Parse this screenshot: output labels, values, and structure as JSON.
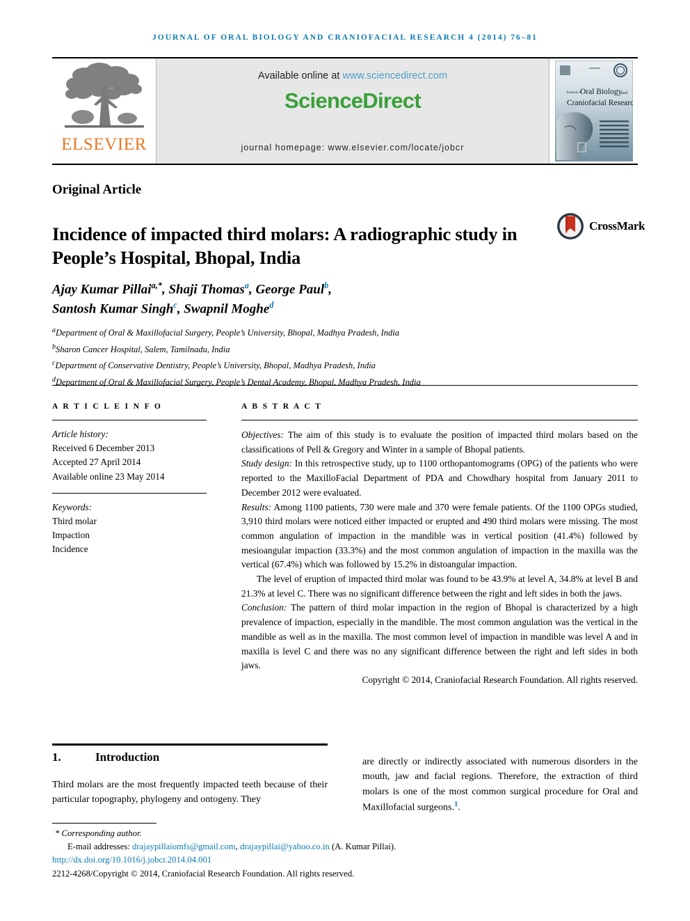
{
  "running_head": "Journal of Oral Biology and Craniofacial Research 4 (2014) 76–81",
  "masthead": {
    "publisher_logo_text": "ELSEVIER",
    "available_prefix": "Available online at ",
    "available_link": "www.sciencedirect.com",
    "sciencedirect_logo": "ScienceDirect",
    "journal_homepage": "journal homepage: www.elsevier.com/locate/jobcr",
    "cover": {
      "title_small": "Journal of",
      "title_main_1": "Oral Biology",
      "title_and": "and",
      "title_main_2": "Craniofacial Research"
    }
  },
  "article": {
    "type": "Original Article",
    "title": "Incidence of impacted third molars: A radiographic study in People’s Hospital, Bhopal, India",
    "crossmark_label": "CrossMark",
    "authors_line_1": "Ajay Kumar Pillai",
    "authors_line_1_sup": "a,*",
    "authors_line_1_b": ", Shaji Thomas",
    "authors_line_1_b_sup": "a",
    "authors_line_1_c": ", George Paul",
    "authors_line_1_c_sup": "b",
    "authors_line_1_end": ",",
    "authors_line_2": "Santosh Kumar Singh",
    "authors_line_2_sup": "c",
    "authors_line_2_b": ", Swapnil Moghe",
    "authors_line_2_b_sup": "d",
    "affiliations": [
      {
        "marker": "a",
        "text": "Department of Oral & Maxillofacial Surgery, People’s University, Bhopal, Madhya Pradesh, India"
      },
      {
        "marker": "b",
        "text": "Sharon Cancer Hospital, Salem, Tamilnadu, India"
      },
      {
        "marker": "c",
        "text": "Department of Conservative Dentistry, People’s University, Bhopal, Madhya Pradesh, India"
      },
      {
        "marker": "d",
        "text": "Department of Oral & Maxillofacial Surgery, People’s Dental Academy, Bhopal, Madhya Pradesh, India"
      }
    ]
  },
  "article_info": {
    "heading": "A R T I C L E  I N F O",
    "history_label": "Article history:",
    "received": "Received 6 December 2013",
    "accepted": "Accepted 27 April 2014",
    "available_online": "Available online 23 May 2014",
    "keywords_label": "Keywords:",
    "keywords": [
      "Third molar",
      "Impaction",
      "Incidence"
    ]
  },
  "abstract": {
    "heading": "A B S T R A C T",
    "objectives_label": "Objectives:",
    "objectives_text": " The aim of this study is to evaluate the position of impacted third molars based on the classifications of Pell & Gregory and Winter in a sample of Bhopal patients.",
    "study_design_label": "Study design:",
    "study_design_text": " In this retrospective study, up to 1100 orthopantomograms (OPG) of the patients who were reported to the MaxilloFacial Department of PDA and Chowdhary hospital from January 2011 to December 2012 were evaluated.",
    "results_label": "Results:",
    "results_text": " Among 1100 patients, 730 were male and 370 were female patients. Of the 1100 OPGs studied, 3,910 third molars were noticed either impacted or erupted and 490 third molars were missing. The most common angulation of impaction in the mandible was in vertical position (41.4%) followed by mesioangular impaction (33.3%) and the most common angulation of impaction in the maxilla was the vertical (67.4%) which was followed by 15.2% in distoangular impaction.",
    "results_paragraph_2": "The level of eruption of impacted third molar was found to be 43.9% at level A, 34.8% at level B and 21.3% at level C. There was no significant difference between the right and left sides in both the jaws.",
    "conclusion_label": "Conclusion:",
    "conclusion_text": " The pattern of third molar impaction in the region of Bhopal is characterized by a high prevalence of impaction, especially in the mandible. The most common angulation was the vertical in the mandible as well as in the maxilla. The most common level of impaction in mandible was level A and in maxilla is level C and there was no any significant difference between the right and left sides in both jaws.",
    "copyright": "Copyright © 2014, Craniofacial Research Foundation. All rights reserved."
  },
  "body": {
    "section_number": "1.",
    "section_title": "Introduction",
    "left_column": "Third molars are the most frequently impacted teeth because of their particular topography, phylogeny and ontogeny. They",
    "right_column": "are directly or indirectly associated with numerous disorders in the mouth, jaw and facial regions. Therefore, the extraction of third molars is one of the most common surgical procedure for Oral and Maxillofacial surgeons.",
    "right_column_ref": "1",
    "right_column_end": "."
  },
  "footnote": {
    "corresponding_star": "*",
    "corresponding_text": "Corresponding author.",
    "email_label": "E-mail addresses:",
    "email_1": "drajaypillaiomfs@gmail.com",
    "email_sep": ", ",
    "email_2": "drajaypillai@yahoo.co.in",
    "email_suffix": " (A. Kumar Pillai).",
    "doi": "http://dx.doi.org/10.1016/j.jobcr.2014.04.001",
    "issn_copyright": "2212-4268/Copyright © 2014, Craniofacial Research Foundation. All rights reserved."
  },
  "colors": {
    "journal_blue": "#0a7ab0",
    "elsevier_orange": "#e87722",
    "sciencedirect_green": "#3aa03a",
    "link_blue": "#4e9ec4",
    "banner_grey": "#e7e7e7"
  }
}
